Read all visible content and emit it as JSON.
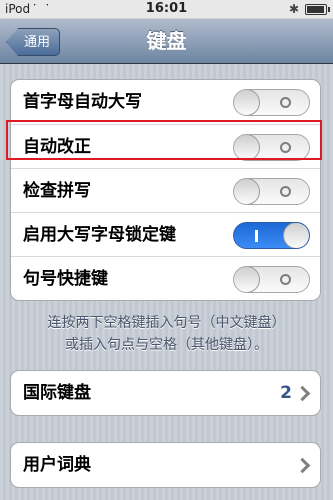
{
  "status_bar": {
    "carrier": "iPod",
    "time": "16:01",
    "battery_level": 0.85
  },
  "nav": {
    "title": "键盘",
    "back_label": "通用"
  },
  "keyboard_settings": [
    {
      "label": "首字母自动大写",
      "enabled": false
    },
    {
      "label": "自动改正",
      "enabled": false
    },
    {
      "label": "检查拼写",
      "enabled": false
    },
    {
      "label": "启用大写字母锁定键",
      "enabled": true
    },
    {
      "label": "句号快捷键",
      "enabled": false
    }
  ],
  "footer_note": {
    "line1": "连按两下空格键插入句号（中文键盘）",
    "line2": "或插入句点与空格（其他键盘）。"
  },
  "international": {
    "label": "国际键盘",
    "value": "2"
  },
  "dictionary": {
    "label": "用户词典"
  },
  "colors": {
    "switch_on": "#2a7de8",
    "highlight": "#e01a25",
    "nav_bar": "#6d84a2"
  }
}
